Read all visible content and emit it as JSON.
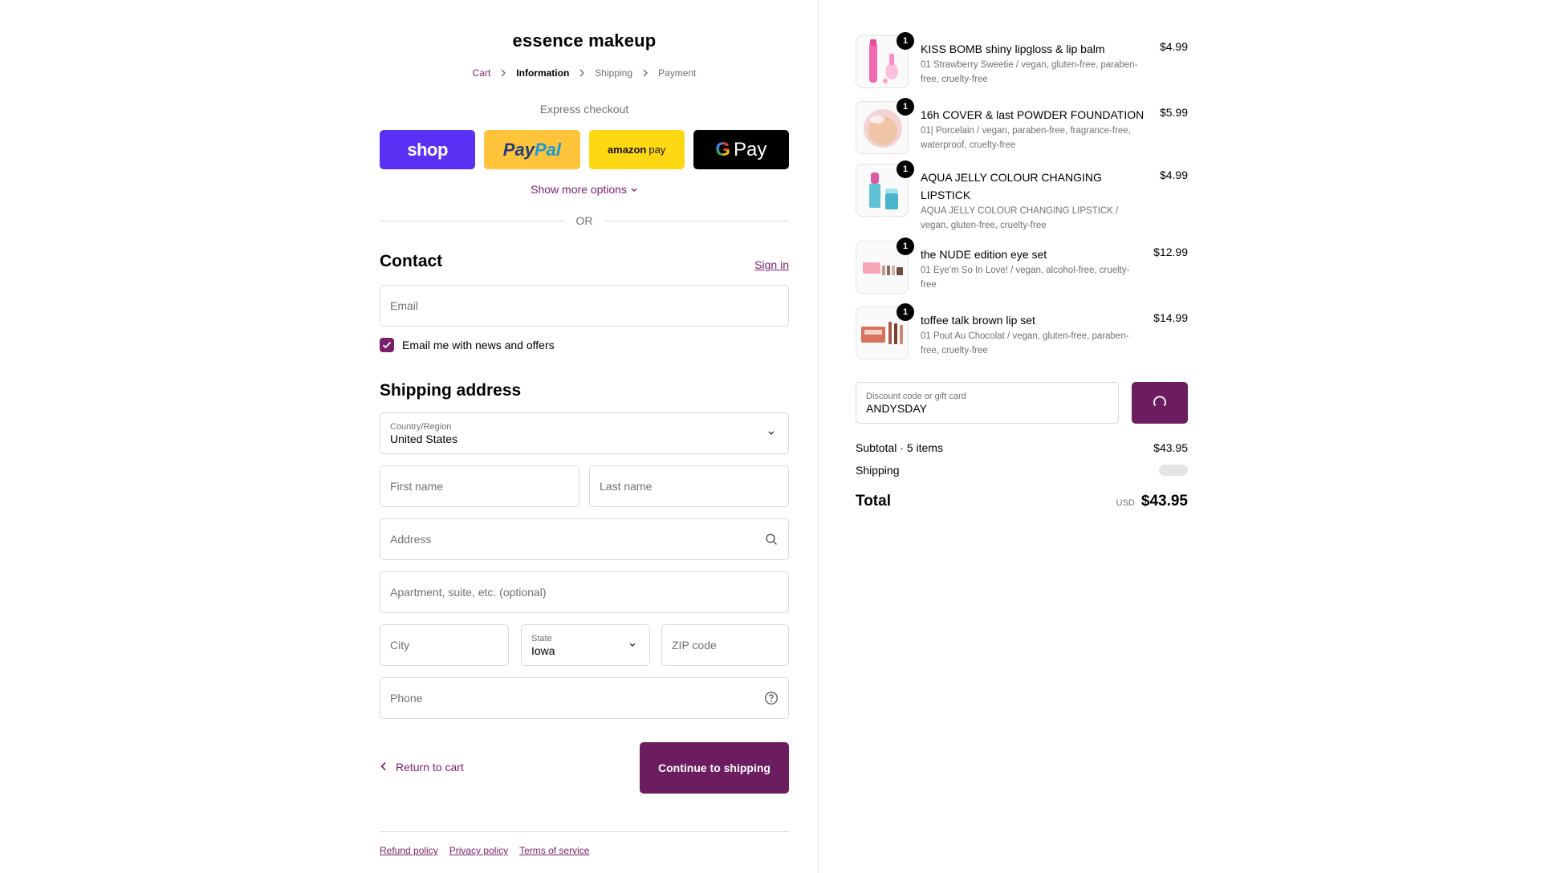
{
  "brand": "essence makeup",
  "breadcrumbs": {
    "cart": "Cart",
    "information": "Information",
    "shipping": "Shipping",
    "payment": "Payment"
  },
  "express": {
    "title": "Express checkout",
    "shop": "shop",
    "paypal_a": "Pay",
    "paypal_b": "Pal",
    "amazon_a": "amazon",
    "amazon_b": "pay",
    "gpay_g": "G",
    "gpay_pay": "Pay",
    "more": "Show more options"
  },
  "or_label": "OR",
  "contact": {
    "heading": "Contact",
    "signin": "Sign in",
    "email_placeholder": "Email",
    "newsletter_label": "Email me with news and offers",
    "newsletter_checked": true
  },
  "shipping": {
    "heading": "Shipping address",
    "country_label": "Country/Region",
    "country_value": "United States",
    "first_name": "First name",
    "last_name": "Last name",
    "address": "Address",
    "apartment": "Apartment, suite, etc. (optional)",
    "city": "City",
    "state_label": "State",
    "state_value": "Iowa",
    "zip": "ZIP code",
    "phone": "Phone"
  },
  "actions": {
    "return": "Return to cart",
    "continue": "Continue to shipping"
  },
  "footer": {
    "refund": "Refund policy",
    "privacy": "Privacy policy",
    "terms": "Terms of service"
  },
  "order": {
    "items": [
      {
        "qty": "1",
        "name": "KISS BOMB shiny lipgloss & lip balm",
        "variant": "01 Strawberry Sweetie / vegan, gluten-free, paraben-free, cruelty-free",
        "price": "$4.99"
      },
      {
        "qty": "1",
        "name": "16h COVER & last POWDER FOUNDATION",
        "variant": "01| Porcelain / vegan, paraben-free, fragrance-free, waterproof, cruelty-free",
        "price": "$5.99"
      },
      {
        "qty": "1",
        "name": "AQUA JELLY COLOUR CHANGING LIPSTICK",
        "variant": "AQUA JELLY COLOUR CHANGING LIPSTICK / vegan, gluten-free, cruelty-free",
        "price": "$4.99"
      },
      {
        "qty": "1",
        "name": "the NUDE edition eye set",
        "variant": "01 Eye'm So In Love! / vegan, alcohol-free, cruelty-free",
        "price": "$12.99"
      },
      {
        "qty": "1",
        "name": "toffee talk brown lip set",
        "variant": "01 Pout Au Chocolat / vegan, gluten-free, paraben-free, cruelty-free",
        "price": "$14.99"
      }
    ],
    "discount_label": "Discount code or gift card",
    "discount_value": "ANDYSDAY",
    "subtotal_label": "Subtotal · 5 items",
    "subtotal_value": "$43.95",
    "shipping_label": "Shipping",
    "total_label": "Total",
    "currency": "USD",
    "total_value": "$43.95"
  },
  "colors": {
    "accent": "#7a1f6b",
    "button": "#6c1d5f",
    "shop_pay": "#5a31f4",
    "paypal": "#ffc439",
    "amazon_pay": "#ffd814",
    "gpay": "#000000"
  }
}
